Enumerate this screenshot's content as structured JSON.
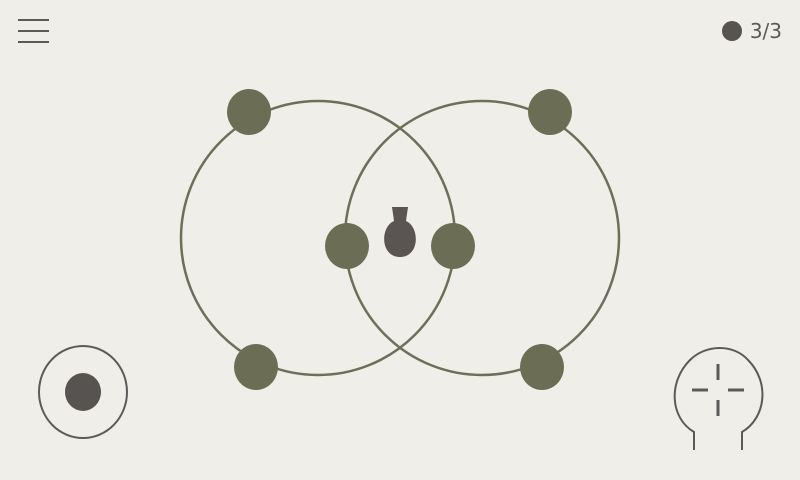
{
  "hud": {
    "menu_icon": "hamburger-menu-icon",
    "counter_text": "3/3",
    "counter_icon": "ball-icon"
  },
  "colors": {
    "background": "#efeee8",
    "ring": "#6e6e5a",
    "node": "#6b6e54",
    "piece": "#5a5553",
    "ui": "#5a5a5a"
  },
  "board": {
    "rings": [
      "left-ring",
      "right-ring"
    ],
    "nodes": [
      "top-left",
      "center-left",
      "bottom-left",
      "top-right",
      "center-right",
      "bottom-right"
    ],
    "piece": "keyhole-piece"
  },
  "controls": {
    "left": "ball-button-icon",
    "right": "crosshair-button-icon"
  }
}
